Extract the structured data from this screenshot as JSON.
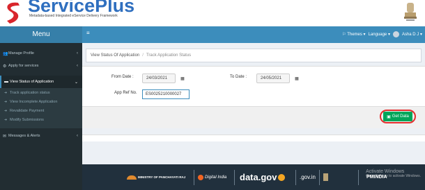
{
  "brand": {
    "name": "ServicePlus",
    "tagline": "Metadata-based Integrated eService Delivery Framework"
  },
  "navbar": {
    "menu_title": "Menu",
    "themes": "Themes",
    "language": "Language",
    "user": "Asha D J"
  },
  "sidebar": {
    "items": [
      {
        "label": "Manage Profile",
        "icon": "users-icon"
      },
      {
        "label": "Apply for services",
        "icon": "gears-icon"
      },
      {
        "label": "View Status of Application",
        "icon": "list-icon"
      },
      {
        "label": "Messages & Alerts",
        "icon": "envelope-icon"
      }
    ],
    "subitems": [
      "Track application status",
      "View Incomplete Application",
      "Revalidate Payment",
      "Modify Submissions"
    ]
  },
  "breadcrumb": {
    "parent": "View Status Of Application",
    "current": "Track Application Status"
  },
  "form": {
    "from_label": "From Date :",
    "from_value": "24/03/2021",
    "to_label": "To Date :",
    "to_value": "24/05/2021",
    "ref_label": "App Ref No.",
    "ref_value": "ES0025210000027"
  },
  "actions": {
    "get_data": "Get Data"
  },
  "partners": {
    "panchayati": "MINISTRY OF PANCHAYATI RAJ",
    "digital_india": "Digital India",
    "datagov": "data.gov",
    "indiagov": ".gov.in",
    "pmindia": "PMINDIA"
  },
  "watermark": {
    "title": "Activate Windows",
    "sub": "Go to Settings to activate Windows."
  },
  "colors": {
    "navbar": "#3c8dbc",
    "sidebar": "#222d32",
    "get_data": "#00a65a",
    "highlight_ring": "#e52d2d"
  }
}
